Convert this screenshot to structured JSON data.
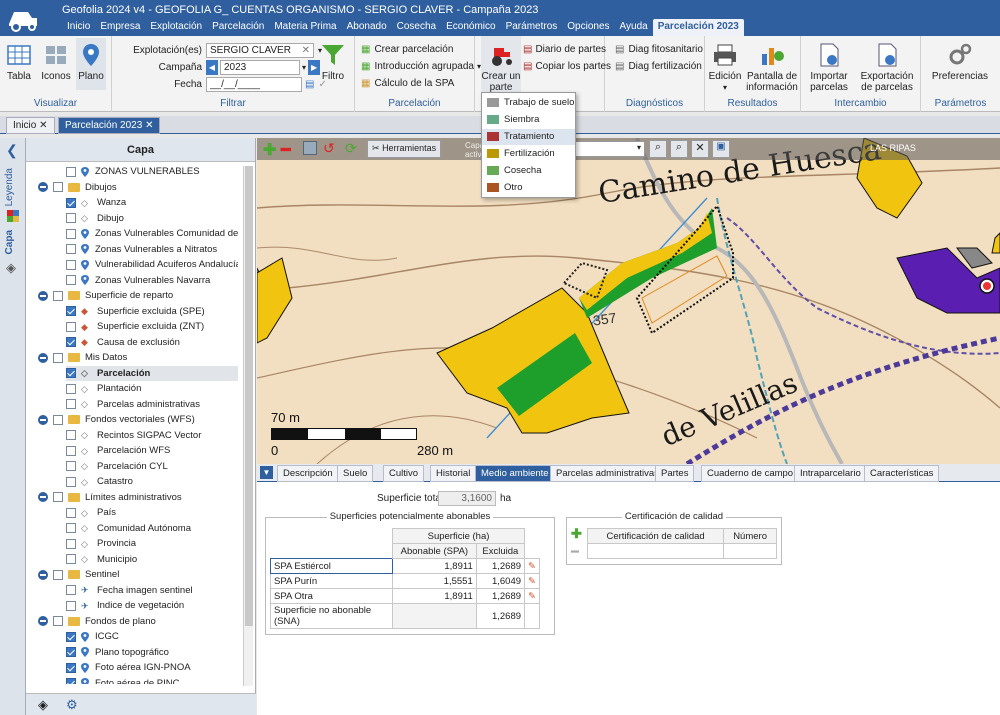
{
  "app": {
    "title": "Geofolia 2024 v4 - GEOFOLIA G_ CUENTAS ORGANISMO - SERGIO CLAVER - Campaña 2023"
  },
  "menu": [
    "Inicio",
    "Empresa",
    "Explotación",
    "Parcelación",
    "Materia Prima",
    "Abonado",
    "Cosecha",
    "Económico",
    "Parámetros",
    "Opciones",
    "Ayuda",
    "Parcelación 2023"
  ],
  "ribbon": {
    "visualizar": {
      "label": "Visualizar",
      "buttons": [
        "Tabla",
        "Iconos",
        "Plano"
      ]
    },
    "filtrar": {
      "label": "Filtrar",
      "explotacion_label": "Explotación(es)",
      "explotacion_value": "SERGIO CLAVER",
      "campana_label": "Campaña",
      "campana_value": "2023",
      "fecha_label": "Fecha",
      "fecha_value": "__/__/____",
      "filtro": "Filtro"
    },
    "parcelacion": {
      "label": "Parcelación",
      "items": [
        "Crear parcelación",
        "Introducción agrupada",
        "Cálculo de la SPA"
      ]
    },
    "crear": {
      "label": "Crear un parte",
      "items": [
        "Diario de partes",
        "Copiar los partes"
      ]
    },
    "diagnosticos": {
      "label": "Diagnósticos",
      "items": [
        "Diag fitosanitario",
        "Diag fertilización"
      ]
    },
    "resultados": {
      "label": "Resultados",
      "buttons": [
        "Edición",
        "Pantalla de información"
      ]
    },
    "intercambio": {
      "label": "Intercambio",
      "buttons": [
        "Importar parcelas",
        "Exportación de parcelas"
      ]
    },
    "parametros": {
      "label": "Parámetros",
      "buttons": [
        "Preferencias"
      ]
    }
  },
  "tabs": [
    "Inicio",
    "Parcelación 2023"
  ],
  "sidestrip": [
    "Leyenda",
    "Capa"
  ],
  "layers": {
    "header": "Capa",
    "items": [
      {
        "t": "ZONAS VULNERABLES",
        "lvl": 2,
        "icon": "pin",
        "on": false
      },
      {
        "t": "Dibujos",
        "lvl": 1,
        "icon": "folder",
        "on": false
      },
      {
        "t": "Wanza",
        "lvl": 2,
        "icon": "draw",
        "on": true
      },
      {
        "t": "Dibujo",
        "lvl": 2,
        "icon": "draw",
        "on": false
      },
      {
        "t": "Zonas Vulnerables Comunidad de Ma",
        "lvl": 2,
        "icon": "pin",
        "on": false
      },
      {
        "t": "Zonas Vulnerables a Nitratos",
        "lvl": 2,
        "icon": "pin",
        "on": false
      },
      {
        "t": "Vulnerabilidad Acuiferos Andalucía",
        "lvl": 2,
        "icon": "pin",
        "on": false
      },
      {
        "t": "Zonas Vulnerables Navarra",
        "lvl": 2,
        "icon": "pin",
        "on": false
      },
      {
        "t": "Superficie de reparto",
        "lvl": 1,
        "icon": "folder",
        "on": false
      },
      {
        "t": "Superficie excluida (SPE)",
        "lvl": 2,
        "icon": "layer",
        "on": true
      },
      {
        "t": "Superficie excluida (ZNT)",
        "lvl": 2,
        "icon": "layer",
        "on": false
      },
      {
        "t": "Causa de exclusión",
        "lvl": 2,
        "icon": "layer",
        "on": true
      },
      {
        "t": "Mis Datos",
        "lvl": 1,
        "icon": "folder",
        "on": false
      },
      {
        "t": "Parcelación",
        "lvl": 2,
        "icon": "draw",
        "on": true,
        "sel": true
      },
      {
        "t": "Plantación",
        "lvl": 2,
        "icon": "draw",
        "on": false
      },
      {
        "t": "Parcelas administrativas",
        "lvl": 2,
        "icon": "draw",
        "on": false
      },
      {
        "t": "Fondos vectoriales (WFS)",
        "lvl": 1,
        "icon": "folder",
        "on": false
      },
      {
        "t": "Recintos SIGPAC Vector",
        "lvl": 2,
        "icon": "draw",
        "on": false
      },
      {
        "t": "Parcelación WFS",
        "lvl": 2,
        "icon": "draw",
        "on": false
      },
      {
        "t": "Parcelación CYL",
        "lvl": 2,
        "icon": "draw",
        "on": false
      },
      {
        "t": "Catastro",
        "lvl": 2,
        "icon": "draw",
        "on": false
      },
      {
        "t": "Límites administrativos",
        "lvl": 1,
        "icon": "folder",
        "on": false
      },
      {
        "t": "País",
        "lvl": 2,
        "icon": "draw",
        "on": false
      },
      {
        "t": "Comunidad Autónoma",
        "lvl": 2,
        "icon": "draw",
        "on": false
      },
      {
        "t": "Provincia",
        "lvl": 2,
        "icon": "draw",
        "on": false
      },
      {
        "t": "Municipio",
        "lvl": 2,
        "icon": "draw",
        "on": false
      },
      {
        "t": "Sentinel",
        "lvl": 1,
        "icon": "folder",
        "on": false
      },
      {
        "t": "Fecha imagen sentinel",
        "lvl": 2,
        "icon": "sat",
        "on": false
      },
      {
        "t": "Indice de vegetación",
        "lvl": 2,
        "icon": "sat",
        "on": false
      },
      {
        "t": "Fondos de plano",
        "lvl": 1,
        "icon": "folder",
        "on": false
      },
      {
        "t": "ICGC",
        "lvl": 2,
        "icon": "pin",
        "on": true
      },
      {
        "t": "Plano topográfico",
        "lvl": 2,
        "icon": "pin",
        "on": true
      },
      {
        "t": "Foto aérea IGN-PNOA",
        "lvl": 2,
        "icon": "pin",
        "on": true
      },
      {
        "t": "Foto aérea de PINC",
        "lvl": 2,
        "icon": "pin",
        "on": true
      }
    ]
  },
  "map": {
    "herramientas": "Herramientas",
    "capa_label": "Capa activa",
    "region": "LAS RIPAS",
    "road1": "Camino de Huesca",
    "road2": "de Velillas",
    "parcel_num": "357",
    "scale_top": "70 m",
    "scale_zero": "0",
    "scale_bottom": "280 m"
  },
  "dropdown": [
    "Trabajo de suelo",
    "Siembra",
    "Tratamiento",
    "Fertilización",
    "Cosecha",
    "Otro"
  ],
  "bottom": {
    "tabs": [
      "Descripción",
      "Suelo",
      "Cultivo",
      "Historial",
      "Medio ambiente",
      "Parcelas administrativas",
      "Partes",
      "Cuaderno de campo",
      "Intraparcelario",
      "Características"
    ],
    "sup_total_label": "Superficie total",
    "sup_total_value": "3,1600",
    "sup_total_unit": "ha",
    "spa_title": "Superficies potencialmente abonables",
    "spa_header": "Superficie (ha)",
    "col1": "Abonable (SPA)",
    "col2": "Excluida",
    "rows": [
      {
        "n": "SPA Estiércol",
        "a": "1,8911",
        "e": "1,2689"
      },
      {
        "n": "SPA Purín",
        "a": "1,5551",
        "e": "1,6049"
      },
      {
        "n": "SPA Otra",
        "a": "1,8911",
        "e": "1,2689"
      },
      {
        "n": "Superficie no abonable (SNA)",
        "a": "",
        "e": "1,2689"
      }
    ],
    "cert_title": "Certificación de calidad",
    "cert_col1": "Certificación de calidad",
    "cert_col2": "Número"
  },
  "colors": {
    "brand": "#2f5f9e",
    "parcel_yellow": "#f1c40f",
    "parcel_green": "#1e9e2a",
    "purple": "#5a1fb0"
  }
}
